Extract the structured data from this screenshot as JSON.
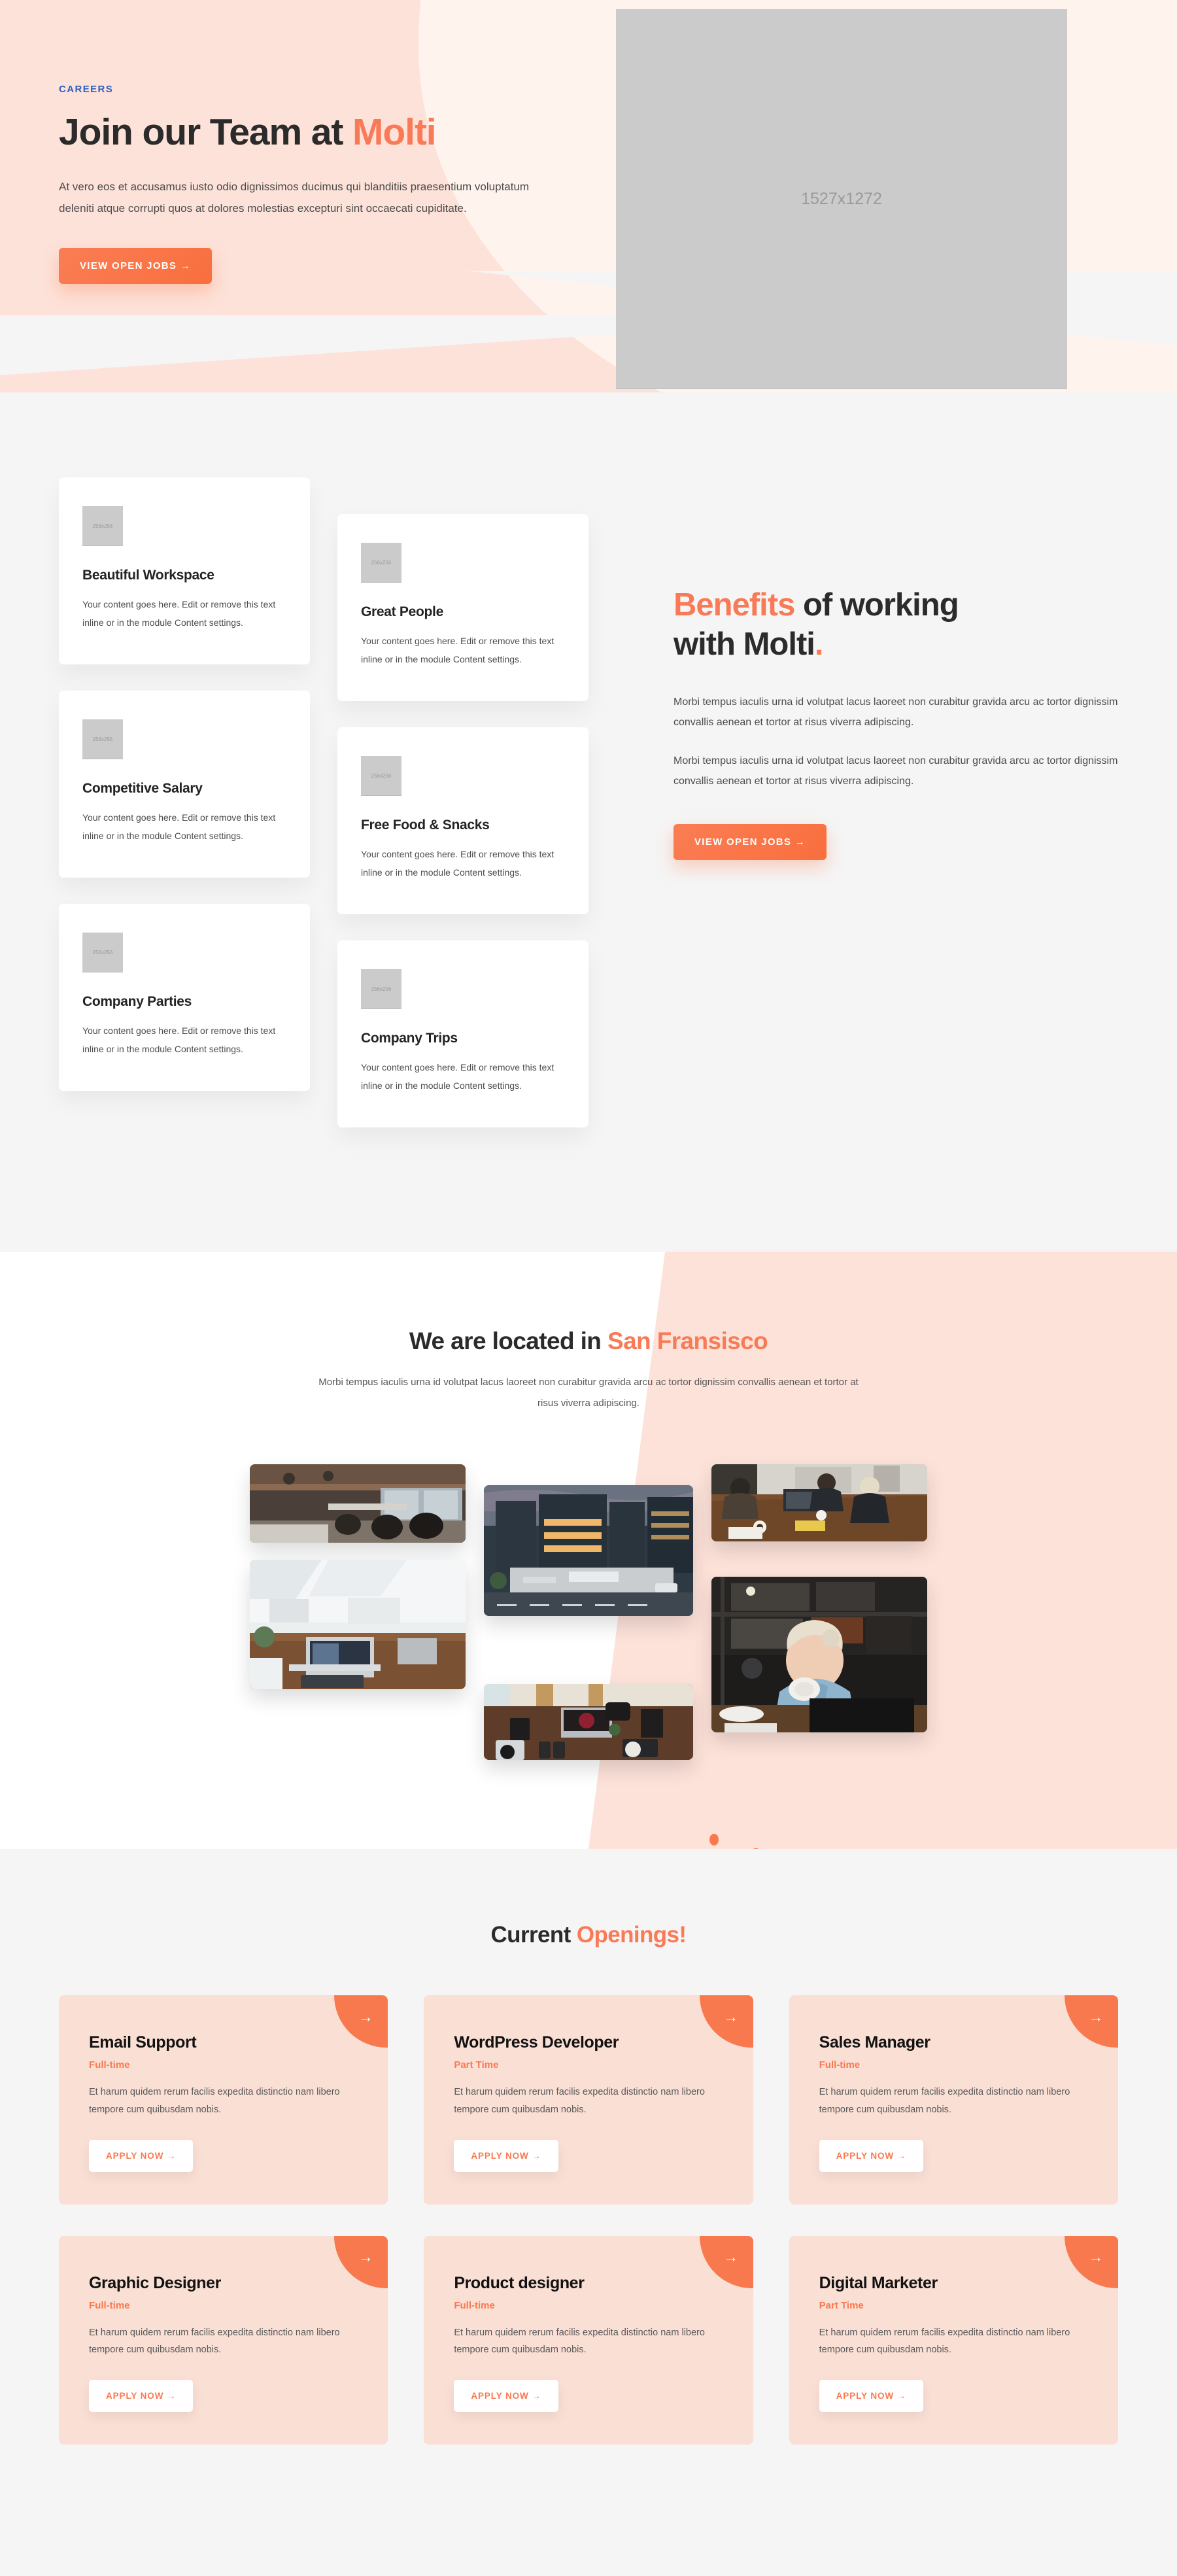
{
  "colors": {
    "accent": "#f9794f",
    "eyebrow_blue": "#2e5fc0",
    "hero_bg": "#fff3ee",
    "hero_blob": "#fde2d9",
    "section_bg": "#f5f5f5",
    "job_card_bg": "#fadfd5",
    "heading": "#2b2b2b"
  },
  "hero": {
    "eyebrow": "CAREERS",
    "title_plain": "Join our Team at ",
    "title_accent": "Molti",
    "body": "At vero eos et accusamus iusto odio dignissimos ducimus qui blanditiis praesentium voluptatum deleniti atque corrupti quos at dolores molestias excepturi sint occaecati cupiditate.",
    "cta": "VIEW OPEN JOBS →",
    "image_placeholder": "1527x1272"
  },
  "benefits": {
    "title_accent": "Benefits",
    "title_plain_1": " of working",
    "title_plain_2": "with Molti",
    "title_dot": ".",
    "paragraph_1": "Morbi tempus iaculis urna id volutpat lacus laoreet non curabitur gravida arcu ac tortor dignissim convallis aenean et tortor at risus viverra adipiscing.",
    "paragraph_2": "Morbi tempus iaculis urna id volutpat lacus laoreet non curabitur gravida arcu ac tortor dignissim convallis aenean et tortor at risus viverra adipiscing.",
    "cta": "VIEW OPEN JOBS →",
    "card_body": "Your content goes here. Edit or remove this text inline or in the module Content settings.",
    "icon_placeholder": "256x256",
    "cards_left": [
      {
        "title": "Beautiful Workspace"
      },
      {
        "title": "Competitive Salary"
      },
      {
        "title": "Company Parties"
      }
    ],
    "cards_right": [
      {
        "title": "Great People"
      },
      {
        "title": "Free Food & Snacks"
      },
      {
        "title": "Company Trips"
      }
    ]
  },
  "location": {
    "title_plain": "We are located in ",
    "title_accent": "San Fransisco",
    "body": "Morbi tempus iaculis urna id volutpat lacus laoreet non curabitur gravida arcu ac tortor dignissim convallis aenean et tortor at risus viverra adipiscing.",
    "photos": [
      {
        "name": "open-plan-office-photo"
      },
      {
        "name": "white-loft-desk-photo"
      },
      {
        "name": "city-building-dusk-photo"
      },
      {
        "name": "home-office-desk-photo"
      },
      {
        "name": "meeting-table-photo"
      },
      {
        "name": "woman-coffee-window-photo"
      }
    ]
  },
  "openings": {
    "title_plain": "Current ",
    "title_accent": "Openings!",
    "apply_label": "APPLY NOW →",
    "arrow_label": "→",
    "description": "Et harum quidem rerum facilis expedita distinctio nam libero tempore cum quibusdam nobis.",
    "jobs": [
      {
        "title": "Email Support",
        "type": "Full-time"
      },
      {
        "title": "WordPress Developer",
        "type": "Part Time"
      },
      {
        "title": "Sales Manager",
        "type": "Full-time"
      },
      {
        "title": "Graphic Designer",
        "type": "Full-time"
      },
      {
        "title": "Product designer",
        "type": "Full-time"
      },
      {
        "title": "Digital Marketer",
        "type": "Part Time"
      }
    ]
  }
}
